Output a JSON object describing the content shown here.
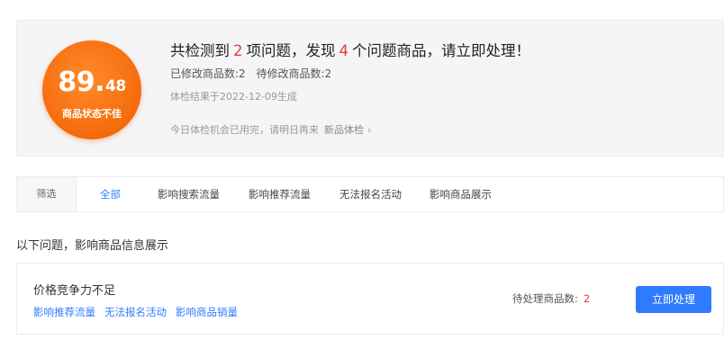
{
  "score": {
    "value_int": "89.",
    "value_dec": "48",
    "label": "商品状态不佳",
    "color": "#f46b0c"
  },
  "summary": {
    "prefix": "共检测到",
    "issue_count": "2",
    "middle": "项问题，发现",
    "product_count": "4",
    "suffix": "个问题商品，请立即处理！"
  },
  "counts": {
    "modified": "已修改商品数:2",
    "pending": "待修改商品数:2"
  },
  "generated": "体检结果于2022-12-09生成",
  "notice": {
    "text": "今日体检机会已用完，请明日再来",
    "link": "新品体检",
    "chevron": "›"
  },
  "tabs": {
    "label": "筛选",
    "items": [
      {
        "label": "全部"
      },
      {
        "label": "影响搜索流量"
      },
      {
        "label": "影响推荐流量"
      },
      {
        "label": "无法报名活动"
      },
      {
        "label": "影响商品展示"
      }
    ]
  },
  "section_title": "以下问题，影响商品信息展示",
  "issue": {
    "title": "价格竞争力不足",
    "tags": [
      "影响推荐流量",
      "无法报名活动",
      "影响商品销量"
    ],
    "pending_label": "待处理商品数:",
    "pending_count": "2",
    "action": "立即处理"
  },
  "colors": {
    "accent": "#2f7bff",
    "highlight": "#e73a3a"
  }
}
